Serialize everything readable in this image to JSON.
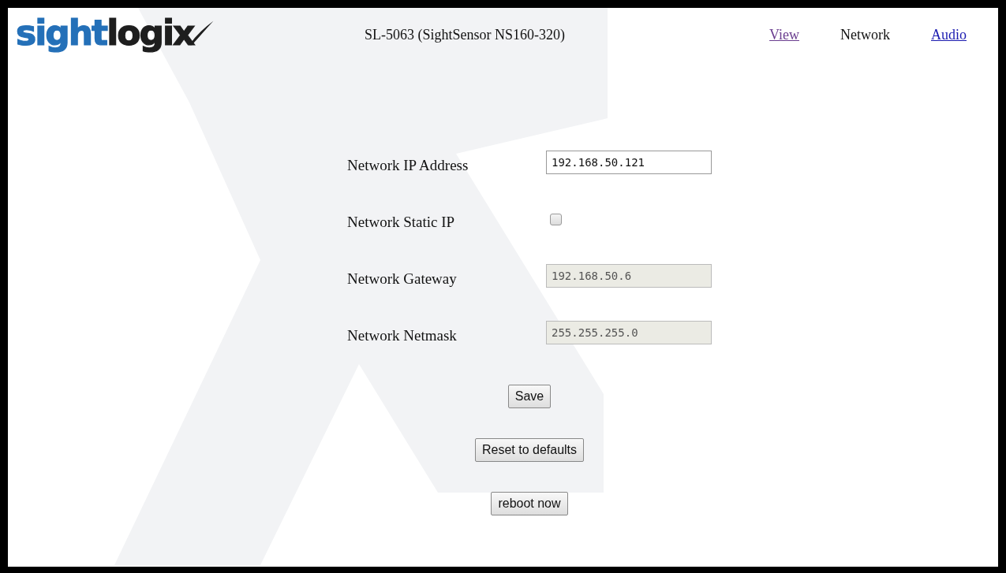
{
  "logo": {
    "parts": [
      {
        "text": "sight",
        "color": "#2470b8"
      },
      {
        "text": "logi",
        "color": "#1e1e1e"
      },
      {
        "text": "x",
        "color": "#1e1e1e"
      }
    ]
  },
  "title": "SL-5063 (SightSensor NS160-320)",
  "nav": [
    {
      "label": "View",
      "selected": false,
      "visited": true
    },
    {
      "label": "Network",
      "selected": true,
      "visited": false
    },
    {
      "label": "Audio",
      "selected": false,
      "visited": false
    }
  ],
  "fields": [
    {
      "kind": "text",
      "label": "Network IP Address",
      "value": "192.168.50.121",
      "disabled": false
    },
    {
      "kind": "checkbox",
      "label": "Network Static IP",
      "checked": false
    },
    {
      "kind": "text",
      "label": "Network Gateway",
      "value": "192.168.50.6",
      "disabled": true
    },
    {
      "kind": "text",
      "label": "Network Netmask",
      "value": "255.255.255.0",
      "disabled": true
    }
  ],
  "buttons": [
    "Save",
    "Reset to defaults",
    "reboot now"
  ]
}
